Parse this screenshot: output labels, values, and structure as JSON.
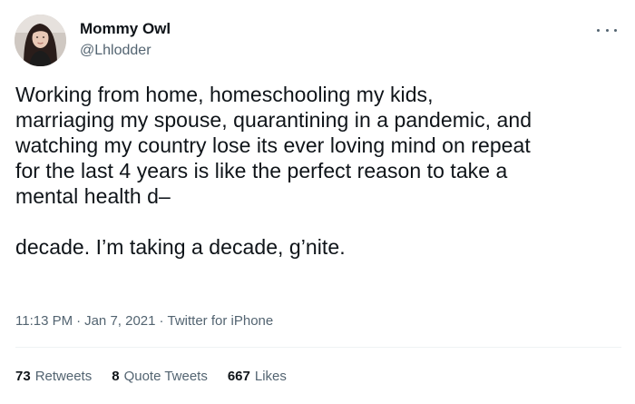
{
  "author": {
    "display_name": "Mommy Owl",
    "handle": "@Lhlodder"
  },
  "tweet": {
    "paragraph_1": "Working from home, homeschooling my kids,\nmarriaging my spouse, quarantining in a pandemic, and\nwatching my country lose its ever loving mind on repeat\nfor the last 4 years is like the perfect reason to take a\nmental health d–",
    "paragraph_2": "decade. I’m taking a decade, g’nite."
  },
  "meta": {
    "time": "11:13 PM",
    "date": "Jan 7, 2021",
    "source": "Twitter for iPhone",
    "separator": "·"
  },
  "stats": {
    "retweets_count": "73",
    "retweets_label": "Retweets",
    "quote_count": "8",
    "quote_label": "Quote Tweets",
    "likes_count": "667",
    "likes_label": "Likes"
  },
  "icons": {
    "more": "more-options-icon",
    "avatar": "profile-photo"
  },
  "colors": {
    "text_primary": "#0f1419",
    "text_secondary": "#536471",
    "divider": "#eff3f4"
  }
}
